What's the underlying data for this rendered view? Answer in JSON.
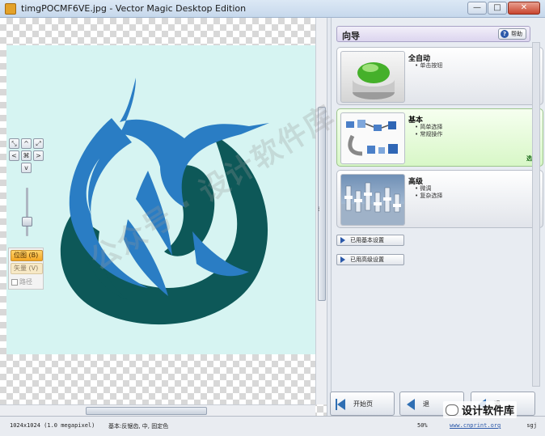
{
  "window": {
    "title": "timgPOCMF6VE.jpg - Vector Magic Desktop Edition",
    "controls": [
      "—",
      "□",
      "✕"
    ]
  },
  "nav_pad": {
    "up": "^",
    "down": "v",
    "left": "<",
    "right": ">",
    "center": "⌘",
    "fit_tl": "⤢",
    "fit_br": "⤡"
  },
  "view_options": {
    "bitmap": "位图 (B)",
    "vector": "矢量 (V)",
    "outline": "路径"
  },
  "wizard": {
    "title": "向导",
    "help_label": "帮助",
    "modes": [
      {
        "title": "全自动",
        "bullets": [
          "单击按钮"
        ]
      },
      {
        "title": "基本",
        "bullets": [
          "简单选择",
          "常规操作"
        ],
        "select_label": "选择"
      },
      {
        "title": "高级",
        "bullets": [
          "微调",
          "复杂选择"
        ]
      }
    ],
    "settings_buttons": [
      "已用基本设置",
      "已用高级设置"
    ]
  },
  "bottom_nav": {
    "home_label": "开始页",
    "back_label": "退",
    "next_label": "退"
  },
  "status": {
    "dims": "1024x1024 (1.0 megapixel)",
    "mode": "基本:反锯齿, 中, 固定色",
    "zoom": "50%",
    "url": "www.cnprint.org",
    "tag": "sgj"
  },
  "watermarks": {
    "diagonal": "公众号 · 设计软件库",
    "brand": "设计软件库"
  },
  "colors": {
    "logo_blue": "#2a7dc4",
    "logo_dark": "#0d5858",
    "image_bg": "#d6f4f2"
  }
}
